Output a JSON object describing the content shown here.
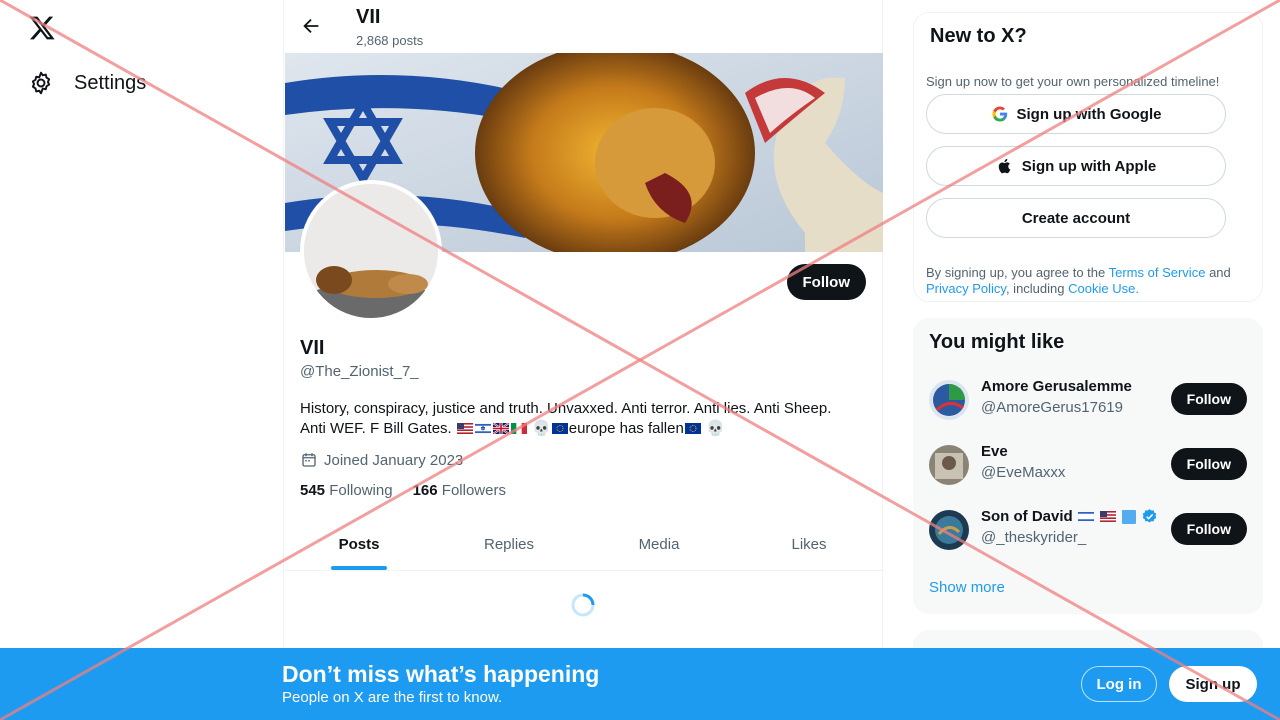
{
  "nav": {
    "settings_label": "Settings"
  },
  "profile": {
    "header_name": "VII",
    "post_count": "2,868 posts",
    "follow_label": "Follow",
    "display_name": "VII",
    "handle": "@The_Zionist_7_",
    "bio_text": "History, conspiracy, justice and truth. Unvaxxed. Anti terror. Anti lies. Anti Sheep. Anti WEF. F Bill Gates. 🇺🇸🇮🇱🇬🇧🇮🇹💀🇪🇺europe has fallen🇪🇺💀",
    "bio_line1": "History, conspiracy, justice and truth. Unvaxxed. Anti terror. Anti lies. Anti Sheep.",
    "bio_line2_start": "Anti WEF. F Bill Gates.",
    "bio_line2_end": "europe has fallen",
    "joined": "Joined January 2023",
    "following_count": "545",
    "following_label": "Following",
    "followers_count": "166",
    "followers_label": "Followers"
  },
  "tabs": [
    {
      "label": "Posts",
      "active": true
    },
    {
      "label": "Replies"
    },
    {
      "label": "Media"
    },
    {
      "label": "Likes"
    }
  ],
  "new_to_x": {
    "title": "New to X?",
    "subtitle": "Sign up now to get your own personalized timeline!",
    "google_label": "Sign up with Google",
    "apple_label": "Sign up with Apple",
    "create_label": "Create account",
    "legal_prefix": "By signing up, you agree to the",
    "terms_link": "Terms of Service",
    "and": "and",
    "privacy_link": "Privacy Policy",
    "including": ", including",
    "cookie_link": "Cookie Use."
  },
  "you_might_like": {
    "title": "You might like",
    "users": [
      {
        "name": "Amore Gerusalemme",
        "handle": "@AmoreGerus17619",
        "follow": "Follow"
      },
      {
        "name": "Eve",
        "handle": "@EveMaxxx",
        "follow": "Follow"
      },
      {
        "name": "Son of David",
        "handle": "@_theskyrider_",
        "follow": "Follow",
        "verified": true
      }
    ],
    "show_more": "Show more"
  },
  "bottom_bar": {
    "headline": "Don’t miss what’s happening",
    "subline": "People on X are the first to know.",
    "login_label": "Log in",
    "signup_label": "Sign up"
  },
  "colors": {
    "accent": "#1d9bf0",
    "text": "#0f1419",
    "muted": "#536471",
    "overlay_x": "#f08080"
  }
}
